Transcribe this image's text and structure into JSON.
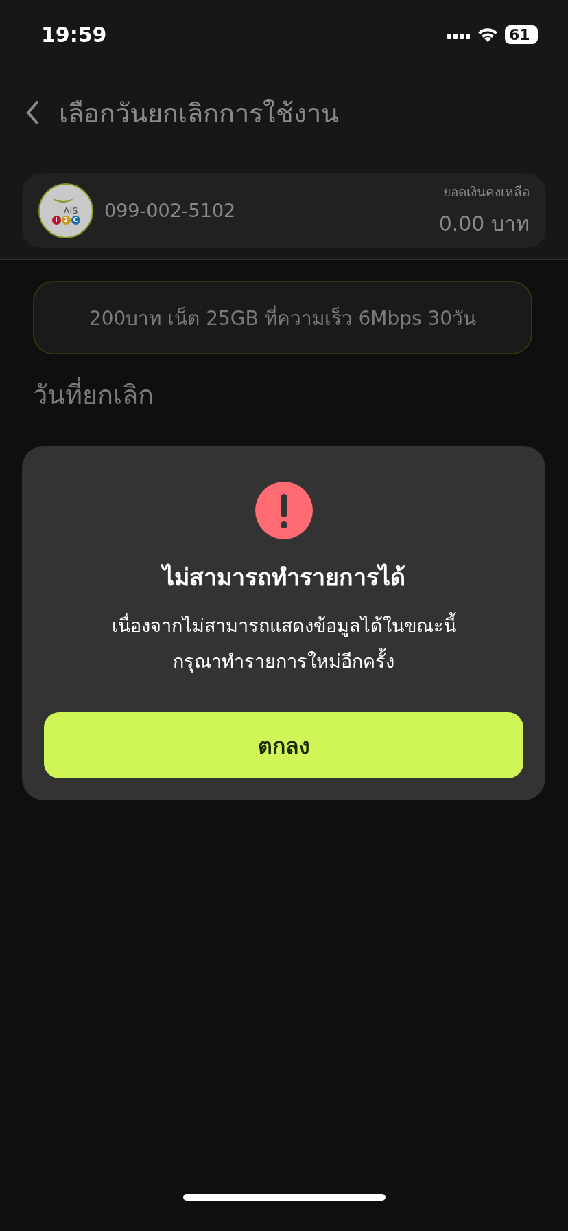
{
  "status_bar": {
    "time": "19:59",
    "battery": "61"
  },
  "header": {
    "title": "เลือกวันยกเลิกการใช้งาน"
  },
  "account": {
    "logo": {
      "brand": "AIS",
      "marks": [
        "I",
        "2",
        "C"
      ]
    },
    "number": "099-002-5102",
    "balance_label": "ยอดเงินคงเหลือ",
    "balance": "0.00 บาท"
  },
  "package": {
    "label": "200บาท เน็ต 25GB ที่ความเร็ว 6Mbps 30วัน"
  },
  "section_title": "วันที่ยกเลิก",
  "dialog": {
    "title": "ไม่สามารถทำรายการได้",
    "message": [
      "เนื่องจากไม่สามารถแสดงข้อมูลได้ในขณะนี้",
      "กรุณาทำรายการใหม่อีกครั้ง"
    ],
    "button": "ตกลง"
  }
}
